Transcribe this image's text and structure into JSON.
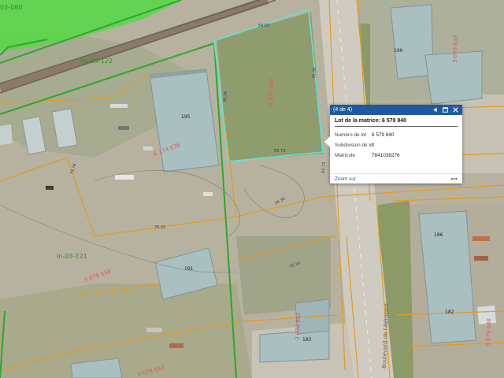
{
  "map": {
    "zone_labels": [
      "Pu-03-122",
      "In-03-121",
      "03-080"
    ],
    "road_label": "Boulevard de l'Aéroport",
    "building_numbers": [
      "195",
      "191",
      "183",
      "190",
      "186",
      "182"
    ],
    "lot_dimensions": [
      "54.55",
      "76.36",
      "55.73",
      "36.36",
      "62.72",
      "73.78",
      "76.32",
      "36.36",
      "35.16"
    ],
    "lot_numbers_red": [
      "6 579 840",
      "6 174 636",
      "3 078 658",
      "3 078 662",
      "3 079 633",
      "3 079 648",
      "3 078 647"
    ],
    "colors": {
      "zone_green": "#5cd64c",
      "zone_line": "#2ba82b",
      "lot_line": "#e59a1f",
      "selected_lot": "#5fe3d6",
      "road": "#d0cbc0",
      "building_roof": "#a9bfc0"
    }
  },
  "popup": {
    "counter": "(4 de 4)",
    "prev_icon": "triangle-left-icon",
    "maximize_icon": "maximize-icon",
    "close_icon": "close-icon",
    "title": "Lot de la matrice: 6 579 840",
    "attributes": [
      {
        "key": "Numéro de lot",
        "value": "6 579 840"
      },
      {
        "key": "Subdivision de lot",
        "value": "/"
      },
      {
        "key": "Matricule",
        "value": "7841038276"
      }
    ],
    "zoom_label": "Zoom sur",
    "more_label": "•••",
    "header_color": "#1f5a9e"
  }
}
